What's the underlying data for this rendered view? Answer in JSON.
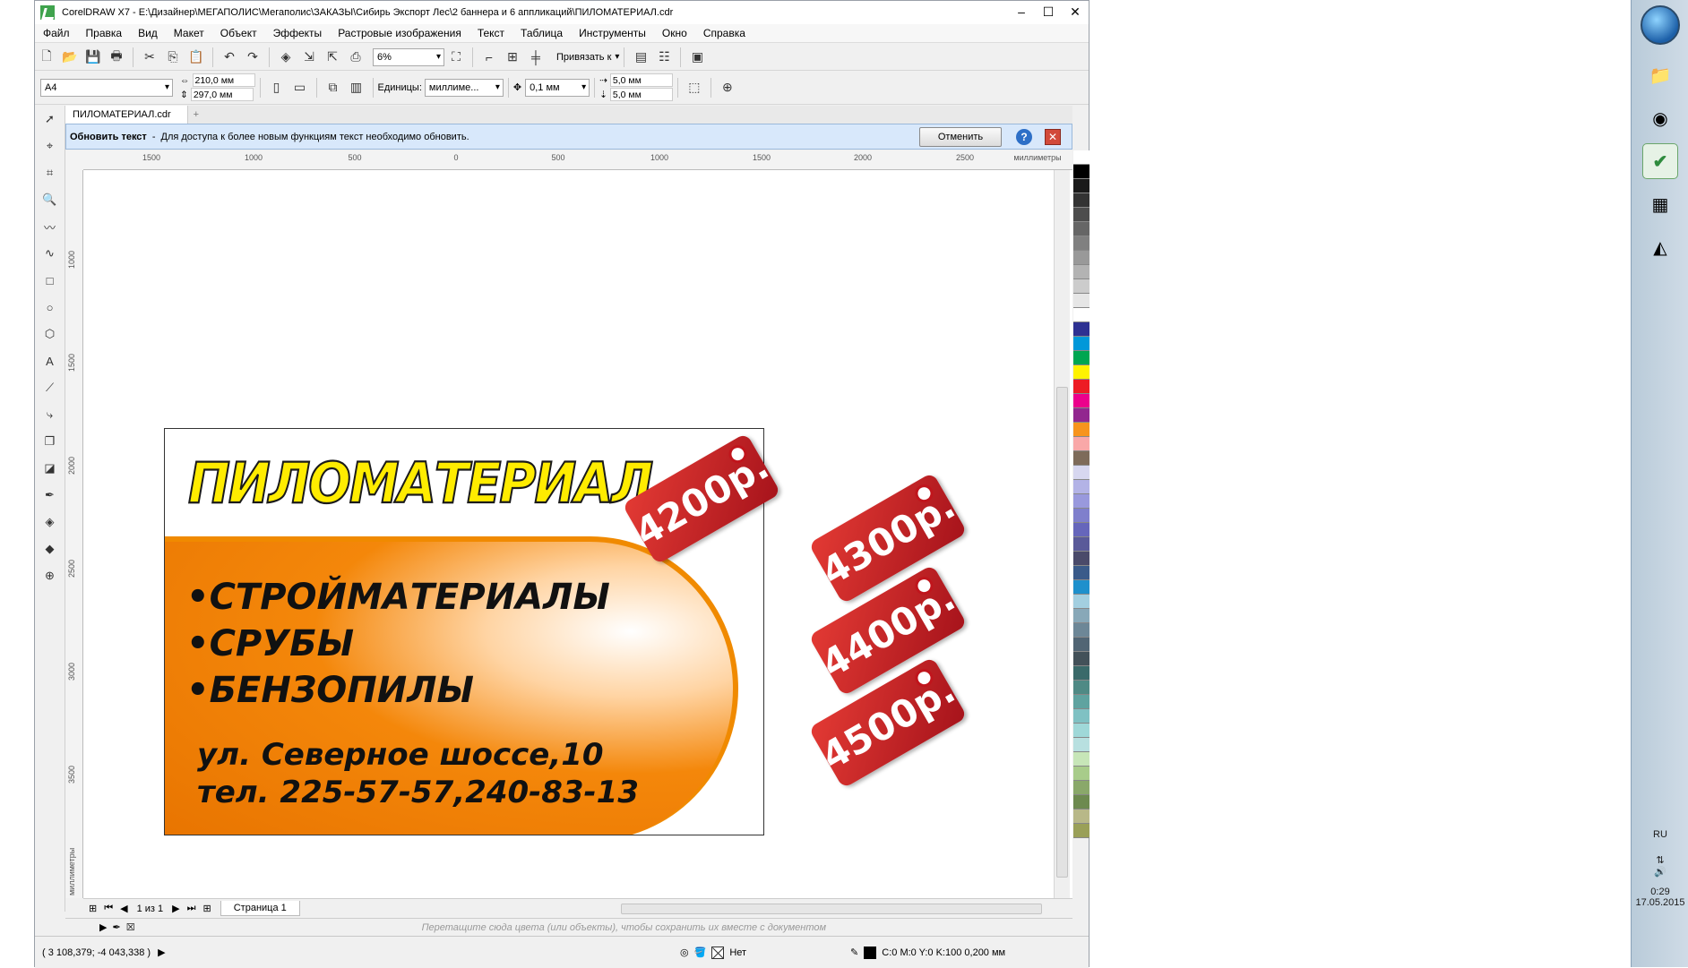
{
  "window": {
    "title": "CorelDRAW X7 - E:\\Дизайнер\\МЕГАПОЛИС\\Мегаполис\\ЗАКАЗЫ\\Сибирь Экспорт Лес\\2 баннера и 6 аппликаций\\ПИЛОМАТЕРИАЛ.cdr"
  },
  "menu": [
    "Файл",
    "Правка",
    "Вид",
    "Макет",
    "Объект",
    "Эффекты",
    "Растровые изображения",
    "Текст",
    "Таблица",
    "Инструменты",
    "Окно",
    "Справка"
  ],
  "toolbar": {
    "zoom": "6%",
    "snap_label": "Привязать к"
  },
  "property_bar": {
    "page_size": "A4",
    "width": "210,0 мм",
    "height": "297,0 мм",
    "units_label": "Единицы:",
    "units_value": "миллиме...",
    "nudge": "0,1 мм",
    "dup_x": "5,0 мм",
    "dup_y": "5,0 мм"
  },
  "doc_tab": "ПИЛОМАТЕРИАЛ.cdr",
  "infobar": {
    "title": "Обновить текст",
    "sep": "-",
    "message": "Для доступа к более новым функциям текст необходимо обновить.",
    "cancel": "Отменить"
  },
  "ruler": {
    "h_labels": [
      "1500",
      "1000",
      "500",
      "0",
      "500",
      "1000",
      "1500",
      "2000",
      "2500"
    ],
    "h_unit": "миллиметры",
    "v_labels": [
      "1000",
      "1500",
      "2000",
      "2500",
      "3000",
      "3500"
    ],
    "v_unit": "миллиметры"
  },
  "design": {
    "headline": "ПИЛОМАТЕРИАЛ",
    "bullets": [
      "•СТРОЙМАТЕРИАЛЫ",
      "•СРУБЫ",
      "•БЕНЗОПИЛЫ"
    ],
    "address": "ул. Северное шоссе,10",
    "phone": "тел. 225-57-57,240-83-13",
    "tags": [
      "4200р.",
      "4300р.",
      "4400р.",
      "4500р."
    ]
  },
  "pagebar": {
    "page_count": "1 из 1",
    "page_tab": "Страница 1"
  },
  "dropbar_hint": "Перетащите сюда цвета (или объекты), чтобы сохранить их вместе с документом",
  "status": {
    "coords": "( 3 108,379; -4 043,338 )",
    "fill": "Нет",
    "outline": "C:0 M:0 Y:0 K:100  0,200 мм"
  },
  "taskbar": {
    "lang": "RU",
    "time": "0:29",
    "date": "17.05.2015"
  },
  "palette_colors": [
    "#ffffff",
    "#000000",
    "#1a1a1a",
    "#333333",
    "#4d4d4d",
    "#666666",
    "#808080",
    "#999999",
    "#b3b3b3",
    "#cccccc",
    "#e6e6e6",
    "#ffffff",
    "#2e3192",
    "#0098d9",
    "#00a651",
    "#fff200",
    "#ed1c24",
    "#ec008c",
    "#92278f",
    "#f7941d",
    "#f9a8a8",
    "#7e6b5a",
    "#d7d7f0",
    "#b3b3e6",
    "#9999dd",
    "#7f7fcc",
    "#6666bb",
    "#5a5a99",
    "#4a4a6a",
    "#3a5b8a",
    "#1e90cc",
    "#a3cfe0",
    "#88a8b8",
    "#6d8797",
    "#516574",
    "#435159",
    "#3a6a6a",
    "#4f8a85",
    "#5fa3a0",
    "#7fc1c3",
    "#9fd8d8",
    "#b8e0e0",
    "#c7e6b8",
    "#a8cc8a",
    "#8aa86a",
    "#6d8a4f",
    "#b8b888",
    "#9aa058"
  ]
}
